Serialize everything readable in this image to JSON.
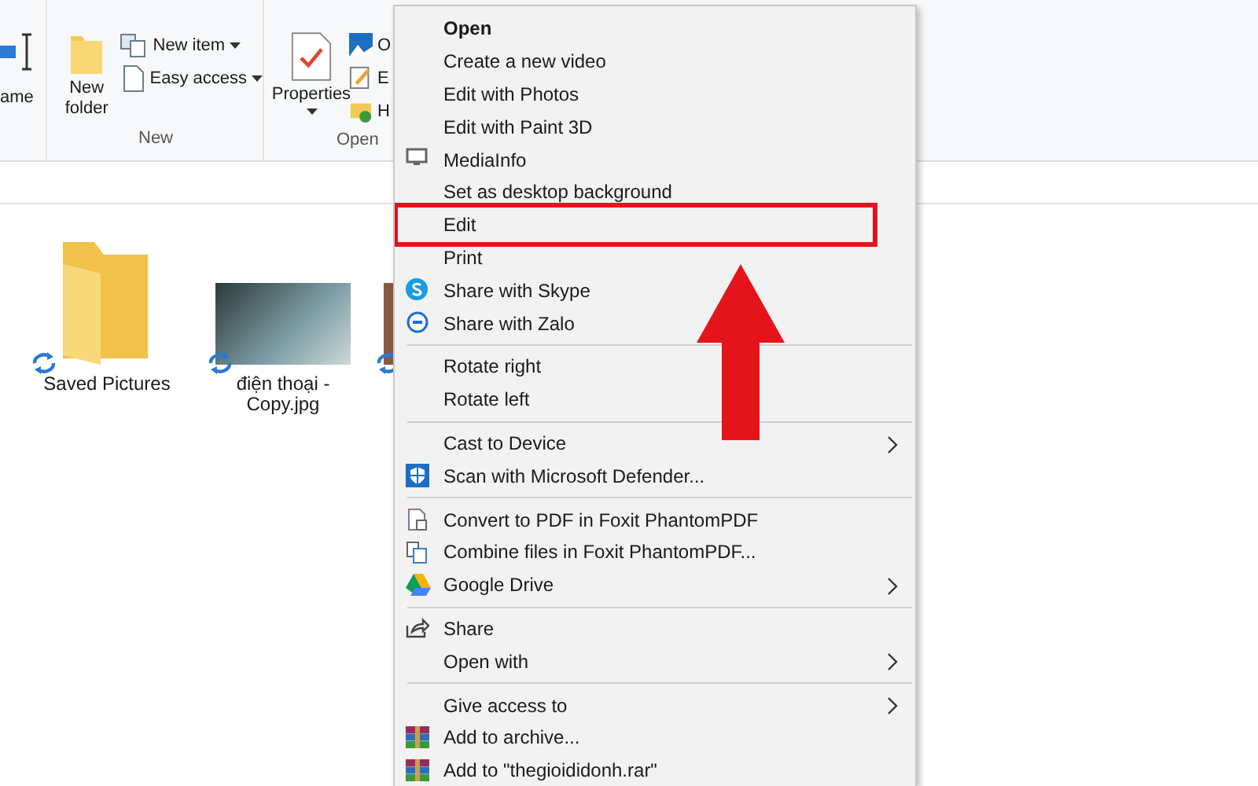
{
  "ribbon": {
    "cut_label": "ame",
    "groups": [
      {
        "label": "New",
        "large": {
          "label": "New folder",
          "dropdown": false
        },
        "small": [
          {
            "label": "New item",
            "dropdown": true
          },
          {
            "label": "Easy access",
            "dropdown": true
          }
        ]
      },
      {
        "label": "Open",
        "large": {
          "label": "Properties",
          "dropdown": true
        },
        "small": [
          {
            "label": "O",
            "dropdown": false
          },
          {
            "label": "E",
            "dropdown": false
          },
          {
            "label": "H",
            "dropdown": false
          }
        ]
      }
    ]
  },
  "files": [
    {
      "kind": "folder",
      "name": "Saved Pictures",
      "syncing": true
    },
    {
      "kind": "image",
      "name": "điện thoại - Copy.jpg",
      "syncing": true
    },
    {
      "kind": "image",
      "syncing": true
    }
  ],
  "menu": {
    "items": [
      {
        "kind": "item",
        "label": "Open",
        "default": true,
        "submenu": false,
        "outlined": false
      },
      {
        "kind": "item",
        "label": "Create a new video",
        "default": false,
        "submenu": false,
        "outlined": false
      },
      {
        "kind": "item",
        "label": "Edit with Photos",
        "default": false,
        "submenu": false,
        "outlined": false
      },
      {
        "kind": "item",
        "label": "Edit with Paint 3D",
        "default": false,
        "submenu": false,
        "outlined": false
      },
      {
        "kind": "item",
        "label": "MediaInfo",
        "default": false,
        "submenu": false,
        "outlined": false
      },
      {
        "kind": "item",
        "label": "Set as desktop background",
        "default": false,
        "submenu": false,
        "outlined": false
      },
      {
        "kind": "item",
        "label": "Edit",
        "default": false,
        "submenu": false,
        "outlined": true
      },
      {
        "kind": "item",
        "label": "Print",
        "default": false,
        "submenu": false,
        "outlined": false
      },
      {
        "kind": "item",
        "label": "Share with Skype",
        "default": false,
        "submenu": false,
        "outlined": false
      },
      {
        "kind": "item",
        "label": "Share with Zalo",
        "default": false,
        "submenu": false,
        "outlined": false
      },
      {
        "kind": "separator"
      },
      {
        "kind": "item",
        "label": "Rotate right",
        "default": false,
        "submenu": false,
        "outlined": false
      },
      {
        "kind": "item",
        "label": "Rotate left",
        "default": false,
        "submenu": false,
        "outlined": false
      },
      {
        "kind": "separator"
      },
      {
        "kind": "item",
        "label": "Cast to Device",
        "default": false,
        "submenu": true,
        "outlined": false
      },
      {
        "kind": "item",
        "label": "Scan with Microsoft Defender...",
        "default": false,
        "submenu": false,
        "outlined": false
      },
      {
        "kind": "separator"
      },
      {
        "kind": "item",
        "label": "Convert to PDF in Foxit PhantomPDF",
        "default": false,
        "submenu": false,
        "outlined": false
      },
      {
        "kind": "item",
        "label": "Combine files in Foxit PhantomPDF...",
        "default": false,
        "submenu": false,
        "outlined": false
      },
      {
        "kind": "item",
        "label": "Google Drive",
        "default": false,
        "submenu": true,
        "outlined": false
      },
      {
        "kind": "separator"
      },
      {
        "kind": "item",
        "label": "Share",
        "default": false,
        "submenu": false,
        "outlined": false
      },
      {
        "kind": "item",
        "label": "Open with",
        "default": false,
        "submenu": true,
        "outlined": false
      },
      {
        "kind": "separator"
      },
      {
        "kind": "item",
        "label": "Give access to",
        "default": false,
        "submenu": true,
        "outlined": false
      },
      {
        "kind": "item",
        "label": "Add to archive...",
        "default": false,
        "submenu": false,
        "outlined": false
      },
      {
        "kind": "item",
        "label": "Add to \"thegioididonh.rar\"",
        "default": false,
        "submenu": false,
        "outlined": false
      }
    ]
  }
}
